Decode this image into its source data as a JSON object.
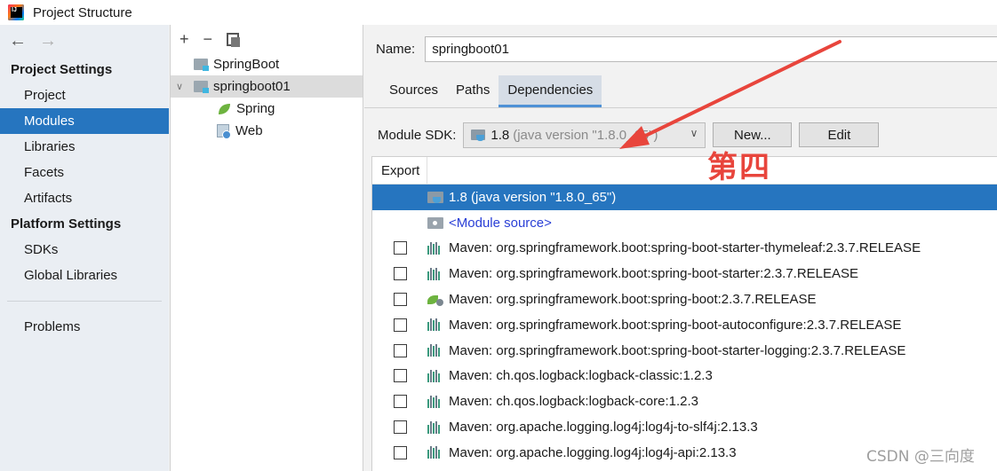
{
  "window": {
    "title": "Project Structure"
  },
  "nav": {
    "back_icon": "arrow-left-icon",
    "forward_icon": "arrow-right-icon",
    "project_settings_header": "Project Settings",
    "project_settings_items": [
      "Project",
      "Modules",
      "Libraries",
      "Facets",
      "Artifacts"
    ],
    "selected_item": "Modules",
    "platform_settings_header": "Platform Settings",
    "platform_settings_items": [
      "SDKs",
      "Global Libraries"
    ],
    "problems": "Problems"
  },
  "module_tree": {
    "toolbar": {
      "add": "+",
      "remove": "−"
    },
    "items": [
      {
        "label": "SpringBoot",
        "level": 0,
        "icon": "module-folder-icon"
      },
      {
        "label": "springboot01",
        "level": 0,
        "icon": "module-folder-icon",
        "selected": true,
        "expanded": true
      },
      {
        "label": "Spring",
        "level": 1,
        "icon": "spring-leaf-icon"
      },
      {
        "label": "Web",
        "level": 1,
        "icon": "web-facet-icon"
      }
    ]
  },
  "module": {
    "name_label": "Name:",
    "name_value": "springboot01",
    "tabs": [
      "Sources",
      "Paths",
      "Dependencies"
    ],
    "active_tab": "Dependencies",
    "sdk_label": "Module SDK:",
    "sdk_value": "1.8",
    "sdk_detail": "(java version \"1.8.0_65\")",
    "new_button": "New...",
    "edit_button": "Edit",
    "export_header": "Export",
    "dependencies": [
      {
        "label": "1.8 (java version \"1.8.0_65\")",
        "type": "sdk",
        "checkbox": false,
        "selected": true
      },
      {
        "label": "<Module source>",
        "type": "source",
        "checkbox": false
      },
      {
        "label": "Maven: org.springframework.boot:spring-boot-starter-thymeleaf:2.3.7.RELEASE",
        "type": "maven",
        "checkbox": true
      },
      {
        "label": "Maven: org.springframework.boot:spring-boot-starter:2.3.7.RELEASE",
        "type": "maven",
        "checkbox": true
      },
      {
        "label": "Maven: org.springframework.boot:spring-boot:2.3.7.RELEASE",
        "type": "spring",
        "checkbox": true
      },
      {
        "label": "Maven: org.springframework.boot:spring-boot-autoconfigure:2.3.7.RELEASE",
        "type": "maven",
        "checkbox": true
      },
      {
        "label": "Maven: org.springframework.boot:spring-boot-starter-logging:2.3.7.RELEASE",
        "type": "maven",
        "checkbox": true
      },
      {
        "label": "Maven: ch.qos.logback:logback-classic:1.2.3",
        "type": "maven",
        "checkbox": true
      },
      {
        "label": "Maven: ch.qos.logback:logback-core:1.2.3",
        "type": "maven",
        "checkbox": true
      },
      {
        "label": "Maven: org.apache.logging.log4j:log4j-to-slf4j:2.13.3",
        "type": "maven",
        "checkbox": true
      },
      {
        "label": "Maven: org.apache.logging.log4j:log4j-api:2.13.3",
        "type": "maven",
        "checkbox": true
      }
    ]
  },
  "annotation": {
    "text": "第四",
    "color": "#e8453c"
  },
  "watermark": "CSDN @三向度",
  "colors": {
    "selection": "#2675bf",
    "link": "#2a3fd6"
  }
}
